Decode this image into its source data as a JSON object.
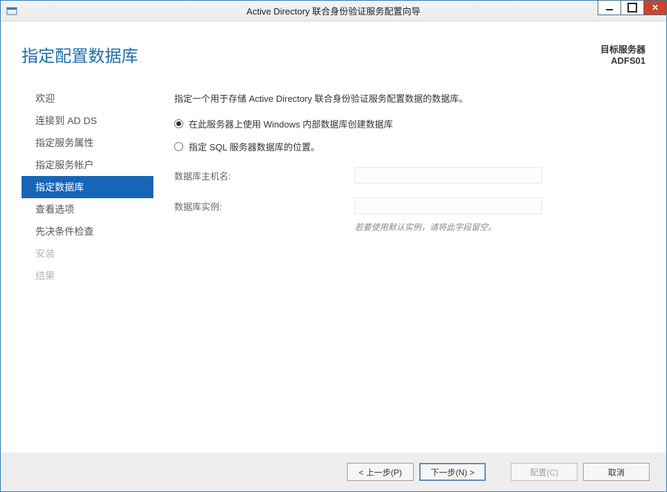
{
  "window": {
    "title": "Active Directory 联合身份验证服务配置向导"
  },
  "header": {
    "page_title": "指定配置数据库",
    "target_label": "目标服务器",
    "target_value": "ADFS01"
  },
  "sidebar": {
    "items": [
      {
        "label": "欢迎",
        "state": "normal"
      },
      {
        "label": "连接到 AD DS",
        "state": "normal"
      },
      {
        "label": "指定服务属性",
        "state": "normal"
      },
      {
        "label": "指定服务帐户",
        "state": "normal"
      },
      {
        "label": "指定数据库",
        "state": "selected"
      },
      {
        "label": "查看选项",
        "state": "normal"
      },
      {
        "label": "先决条件检查",
        "state": "normal"
      },
      {
        "label": "安装",
        "state": "disabled"
      },
      {
        "label": "结果",
        "state": "disabled"
      }
    ]
  },
  "main": {
    "description": "指定一个用于存储 Active Directory 联合身份验证服务配置数据的数据库。",
    "radio1": "在此服务器上使用 Windows 内部数据库创建数据库",
    "radio2": "指定 SQL 服务器数据库的位置。",
    "radio_selected": 0,
    "host_label": "数据库主机名:",
    "host_value": "",
    "instance_label": "数据库实例:",
    "instance_value": "",
    "instance_hint": "若要使用默认实例，请将此字段留空。"
  },
  "footer": {
    "prev": "< 上一步(P)",
    "next": "下一步(N) >",
    "configure": "配置(C)",
    "cancel": "取消"
  }
}
